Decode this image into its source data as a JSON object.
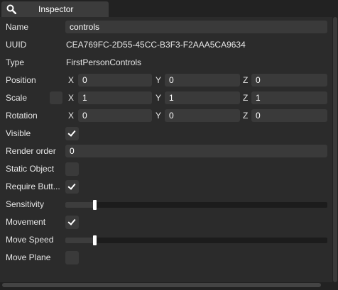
{
  "tab": {
    "label": "Inspector",
    "icon": "search-icon"
  },
  "name": {
    "label": "Name",
    "value": "controls"
  },
  "uuid": {
    "label": "UUID",
    "value": "CEA769FC-2D55-45CC-B3F3-F2AAA5CA9634"
  },
  "type": {
    "label": "Type",
    "value": "FirstPersonControls"
  },
  "axes": {
    "x": "X",
    "y": "Y",
    "z": "Z"
  },
  "position": {
    "label": "Position",
    "x": "0",
    "y": "0",
    "z": "0"
  },
  "scale": {
    "label": "Scale",
    "x": "1",
    "y": "1",
    "z": "1"
  },
  "rotation": {
    "label": "Rotation",
    "x": "0",
    "y": "0",
    "z": "0"
  },
  "visible": {
    "label": "Visible",
    "checked": true
  },
  "render_order": {
    "label": "Render order",
    "value": "0"
  },
  "static_object": {
    "label": "Static Object",
    "checked": false
  },
  "require_button": {
    "label": "Require Butt...",
    "checked": true
  },
  "sensitivity": {
    "label": "Sensitivity",
    "level": 0.11
  },
  "movement": {
    "label": "Movement",
    "checked": true
  },
  "move_speed": {
    "label": "Move Speed",
    "level": 0.11
  },
  "move_plane": {
    "label": "Move Plane",
    "checked": false
  },
  "colors": {
    "background": "#222222",
    "panel": "#2b2b2b",
    "field": "#3a3a3a",
    "text": "#e6e6e6"
  }
}
